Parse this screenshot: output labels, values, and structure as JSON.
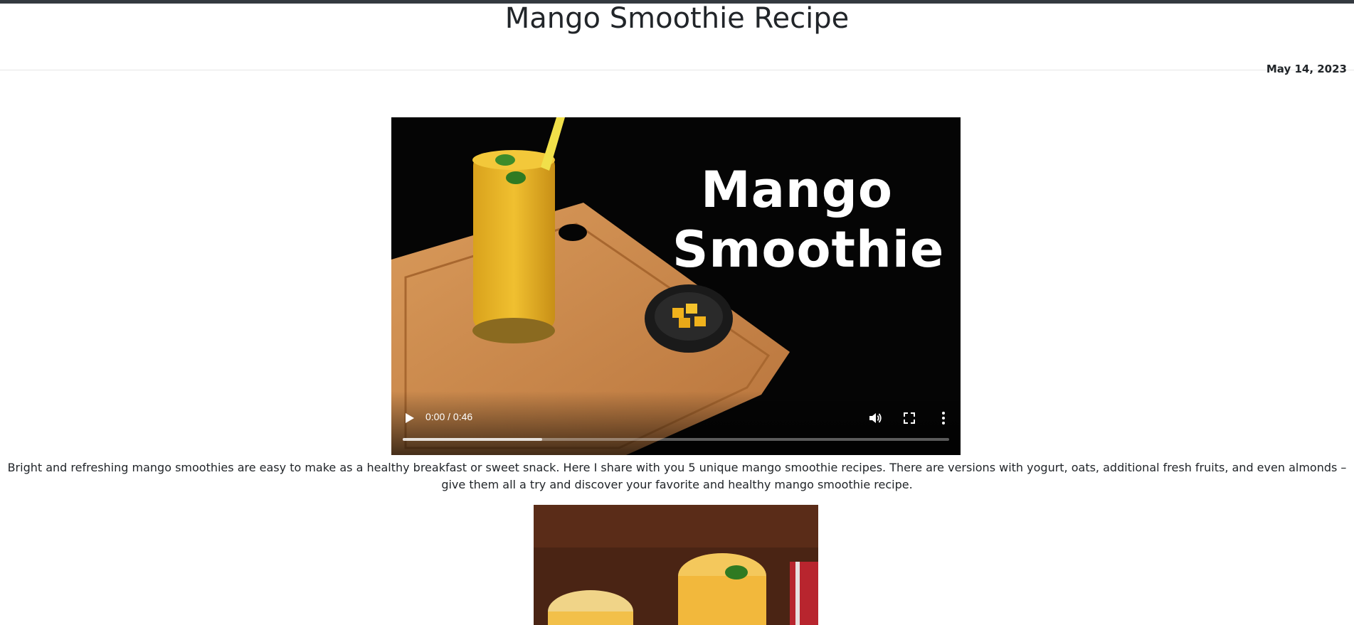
{
  "page": {
    "title": "Mango Smoothie Recipe",
    "date": "May 14, 2023"
  },
  "video": {
    "overlay_title_line1": "Mango",
    "overlay_title_line2": "Smoothie",
    "time": "0:00 / 0:46",
    "buffered_fraction": 0.255,
    "icons": {
      "play": "play-icon",
      "volume": "volume-icon",
      "fullscreen": "fullscreen-icon",
      "more": "more-vertical-icon"
    }
  },
  "intro_text": "Bright and refreshing mango smoothies are easy to make as a healthy breakfast or sweet snack. Here I share with you 5 unique mango smoothie recipes. There are versions with yogurt, oats, additional fresh fruits, and even almonds – give them all a try and discover your favorite and healthy mango smoothie recipe.",
  "colors": {
    "top_bar": "#343a40",
    "text": "#212529",
    "smoothie": "#e8b625",
    "board": "#c98a4c"
  }
}
